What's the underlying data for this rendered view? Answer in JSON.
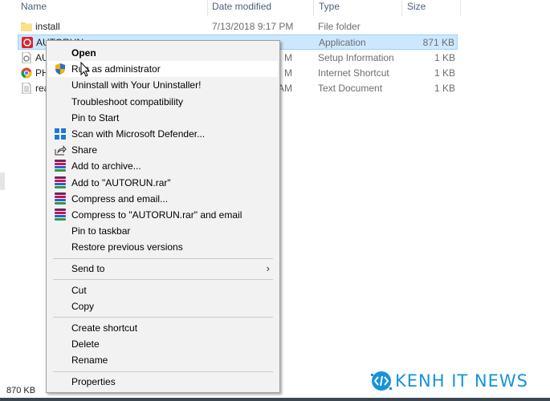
{
  "columns": {
    "name": "Name",
    "date": "Date modified",
    "type": "Type",
    "size": "Size"
  },
  "files": [
    {
      "name": "install",
      "date": "7/13/2018 9:17 PM",
      "type": "File folder",
      "size": "",
      "icon": "folder-icon"
    },
    {
      "name": "AUTORUN",
      "date": "",
      "type": "Application",
      "size": "871 KB",
      "icon": "application-icon",
      "selected": true
    },
    {
      "name": "AU",
      "date": "M",
      "type": "Setup Information",
      "size": "1 KB",
      "icon": "setup-file-icon"
    },
    {
      "name": "PH",
      "date": "M",
      "type": "Internet Shortcut",
      "size": "1 KB",
      "icon": "internet-shortcut-icon"
    },
    {
      "name": "rea",
      "date": "AM",
      "type": "Text Document",
      "size": "1 KB",
      "icon": "text-document-icon"
    }
  ],
  "context_menu": {
    "items": [
      {
        "label": "Open",
        "bold": true
      },
      {
        "label": "Run as administrator",
        "icon": "uac-shield",
        "highlighted": true
      },
      {
        "label": "Uninstall with Your Uninstaller!"
      },
      {
        "label": "Troubleshoot compatibility"
      },
      {
        "label": "Pin to Start"
      },
      {
        "label": "Scan with Microsoft Defender...",
        "icon": "defender"
      },
      {
        "label": "Share",
        "icon": "share"
      },
      {
        "label": "Add to archive...",
        "icon": "winrar"
      },
      {
        "label": "Add to \"AUTORUN.rar\"",
        "icon": "winrar"
      },
      {
        "label": "Compress and email...",
        "icon": "winrar"
      },
      {
        "label": "Compress to \"AUTORUN.rar\" and email",
        "icon": "winrar"
      },
      {
        "label": "Pin to taskbar"
      },
      {
        "label": "Restore previous versions"
      },
      {
        "separator": true
      },
      {
        "label": "Send to",
        "submenu": true
      },
      {
        "separator": true
      },
      {
        "label": "Cut"
      },
      {
        "label": "Copy"
      },
      {
        "separator": true
      },
      {
        "label": "Create shortcut"
      },
      {
        "label": "Delete"
      },
      {
        "label": "Rename"
      },
      {
        "separator": true
      },
      {
        "label": "Properties"
      }
    ]
  },
  "status": {
    "selected_size": "870 KB"
  },
  "watermark": {
    "text": "KENH IT NEWS"
  },
  "colors": {
    "selection": "#cce8ff",
    "accent": "#1793d8"
  }
}
